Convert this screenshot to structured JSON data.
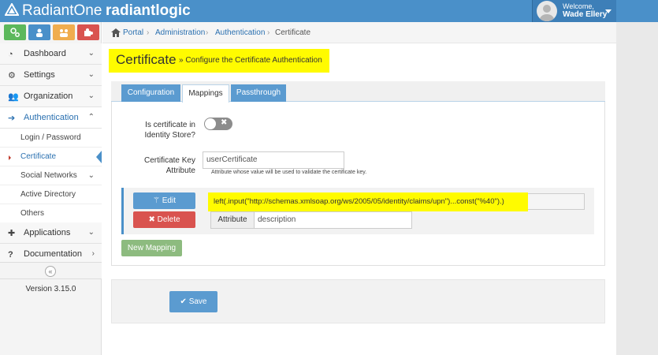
{
  "header": {
    "brand": "RadiantOne",
    "product": "radiantlogic",
    "welcome": "Welcome,",
    "user_name": "Wade Ellery",
    "brand_color": "#4a90c9"
  },
  "toolbar": {
    "tiles": [
      {
        "icon": "settings-icon",
        "color": "#5cb85c"
      },
      {
        "icon": "user-icon",
        "color": "#4a90c9"
      },
      {
        "icon": "group-icon",
        "color": "#f0ad4e"
      },
      {
        "icon": "puzzle-icon",
        "color": "#d9534f"
      }
    ]
  },
  "sidebar": {
    "items": [
      {
        "label": "Dashboard",
        "icon": "dashboard-icon"
      },
      {
        "label": "Settings",
        "icon": "cogs-icon"
      },
      {
        "label": "Organization",
        "icon": "users-icon"
      },
      {
        "label": "Authentication",
        "icon": "sign-in-icon"
      },
      {
        "label": "Applications",
        "icon": "puzzle-icon"
      },
      {
        "label": "Documentation",
        "icon": "question-icon"
      }
    ],
    "sub_items": [
      {
        "label": "Login / Password"
      },
      {
        "label": "Certificate"
      },
      {
        "label": "Social Networks"
      },
      {
        "label": "Active Directory"
      },
      {
        "label": "Others"
      }
    ],
    "version": "Version 3.15.0"
  },
  "breadcrumb": {
    "items": [
      "Portal",
      "Administration",
      "Authentication",
      "Certificate"
    ],
    "separator": "›"
  },
  "page": {
    "title": "Certificate",
    "subtitle": "» Configure the Certificate Authentication",
    "highlight_color": "#fffb00"
  },
  "tabs": [
    {
      "label": "Configuration",
      "active": false
    },
    {
      "label": "Mappings",
      "active": true
    },
    {
      "label": "Passthrough",
      "active": false
    }
  ],
  "form": {
    "identity_store_label": "Is certificate in Identity Store?",
    "identity_store_value": false,
    "cert_key_label": "Certificate Key Attribute",
    "cert_key_value": "userCertificate",
    "cert_key_help": "Attribute whose value will be used to validate the certificate key."
  },
  "mapping": {
    "edit_label": "Edit",
    "delete_label": "Delete",
    "expression": "left(.input(\"http://schemas.xmlsoap.org/ws/2005/05/identity/claims/upn\")...const(\"%40\").)",
    "attribute_label": "Attribute",
    "attribute_value": "description",
    "new_mapping_label": "New Mapping"
  },
  "actions": {
    "save_label": "Save"
  }
}
